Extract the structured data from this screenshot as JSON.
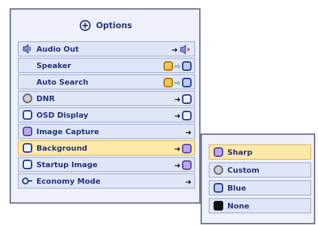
{
  "menu": {
    "title": "Options",
    "items": [
      {
        "label": "Audio Out",
        "icon": "speaker-icon"
      },
      {
        "label": "Speaker",
        "icon": ""
      },
      {
        "label": "Auto Search",
        "icon": ""
      },
      {
        "label": "DNR",
        "icon": "dnr-icon"
      },
      {
        "label": "OSD Display",
        "icon": "osd-icon"
      },
      {
        "label": "Image Capture",
        "icon": "image-capture-icon"
      },
      {
        "label": "Background",
        "icon": "background-icon",
        "selected": true
      },
      {
        "label": "Startup Image",
        "icon": "startup-image-icon"
      },
      {
        "label": "Economy Mode",
        "icon": "economy-icon"
      }
    ]
  },
  "submenu": {
    "items": [
      {
        "label": "Sharp",
        "icon": "sharp-icon",
        "selected": true
      },
      {
        "label": "Custom",
        "icon": "custom-icon"
      },
      {
        "label": "Blue",
        "icon": "blue-icon"
      },
      {
        "label": "None",
        "icon": "none-icon"
      }
    ]
  },
  "colors": {
    "panel_bg": "#eef1fb",
    "row_bg": "#dfe6f8",
    "selected_row_bg": "#ffe9a8",
    "text": "#23357a",
    "border": "#6f7790"
  }
}
